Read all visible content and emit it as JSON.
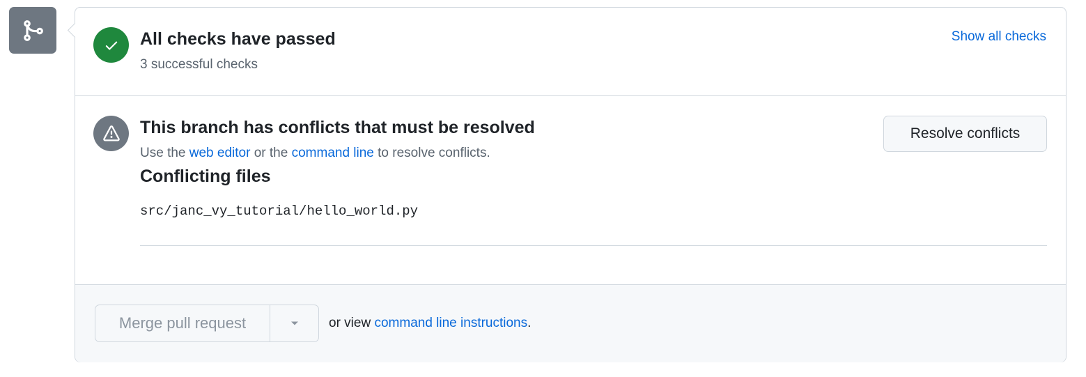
{
  "checks": {
    "title": "All checks have passed",
    "subtitle": "3 successful checks",
    "show_all_label": "Show all checks"
  },
  "conflicts": {
    "title": "This branch has conflicts that must be resolved",
    "desc_prefix": "Use the ",
    "web_editor_label": "web editor",
    "desc_middle": " or the ",
    "command_line_label": "command line",
    "desc_suffix": " to resolve conflicts.",
    "resolve_label": "Resolve conflicts",
    "files_heading": "Conflicting files",
    "files": [
      "src/janc_vy_tutorial/hello_world.py"
    ]
  },
  "footer": {
    "merge_label": "Merge pull request",
    "text_prefix": "or view ",
    "instructions_label": "command line instructions",
    "text_suffix": "."
  },
  "icons": {
    "merge": "git-merge-icon",
    "check": "check-icon",
    "alert": "alert-icon",
    "caret": "triangle-down-icon"
  },
  "colors": {
    "success": "#1f883d",
    "link": "#0969da",
    "neutral": "#6e7781"
  }
}
